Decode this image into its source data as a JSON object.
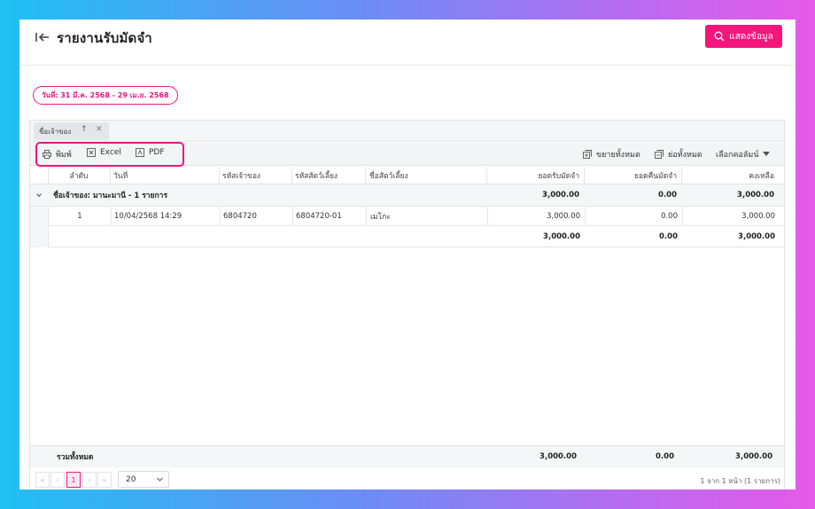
{
  "header": {
    "title": "รายงานรับมัดจำ",
    "show_button_label": "แสดงข้อมูล"
  },
  "filter": {
    "date_range": "วันที่: 31 มี.ค. 2568 - 29 เม.ย. 2568"
  },
  "grouping": {
    "chip_label": "ชื่อเจ้าของ"
  },
  "toolbar": {
    "print_label": "พิมพ์",
    "excel_label": "Excel",
    "pdf_label": "PDF",
    "expand_all_label": "ขยายทั้งหมด",
    "collapse_all_label": "ย่อทั้งหมด",
    "choose_columns_label": "เลือกคอลัมน์"
  },
  "columns": {
    "seq": "ลำดับ",
    "date": "วันที่",
    "owner_code": "รหัสเจ้าของ",
    "pet_code": "รหัสสัตว์เลี้ยง",
    "pet_name": "ชื่อสัตว์เลี้ยง",
    "deposit_received": "ยอดรับมัดจำ",
    "deposit_returned": "ยอดคืนมัดจำ",
    "balance": "คงเหลือ"
  },
  "group": {
    "label": "ชื่อเจ้าของ: มานะมานี - 1 รายการ",
    "deposit_received": "3,000.00",
    "deposit_returned": "0.00",
    "balance": "3,000.00"
  },
  "rows": [
    {
      "seq": "1",
      "date": "10/04/2568 14:29",
      "owner_code": "6804720",
      "pet_code": "6804720-01",
      "pet_name": "เมโกะ",
      "deposit_received": "3,000.00",
      "deposit_returned": "0.00",
      "balance": "3,000.00"
    }
  ],
  "subtotal": {
    "deposit_received": "3,000.00",
    "deposit_returned": "0.00",
    "balance": "3,000.00"
  },
  "total": {
    "label": "รวมทั้งหมด",
    "deposit_received": "3,000.00",
    "deposit_returned": "0.00",
    "balance": "3,000.00"
  },
  "pager": {
    "current_page": "1",
    "page_size": "20",
    "info": "1 จาก 1 หน้า (1 รายการ)"
  },
  "colors": {
    "accent": "#f5157c",
    "header_bg": "#f5f6f8"
  },
  "icons": [
    "back-arrow-icon",
    "search-icon",
    "print-icon",
    "excel-icon",
    "pdf-icon",
    "expand-icon",
    "collapse-icon",
    "chevron-down-icon",
    "sort-asc-icon",
    "close-icon"
  ]
}
